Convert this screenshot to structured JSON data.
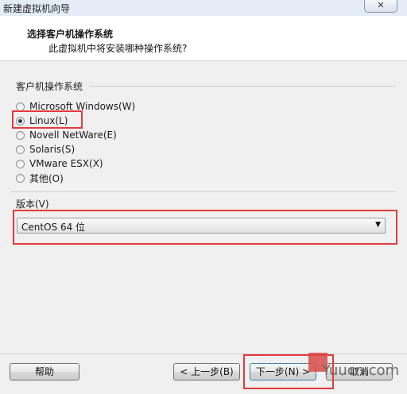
{
  "window": {
    "title": "新建虚拟机向导",
    "close_label": "✕"
  },
  "header": {
    "title": "选择客户机操作系统",
    "subtitle": "此虚拟机中将安装哪种操作系统?"
  },
  "os_group": {
    "label": "客户机操作系统",
    "options": [
      {
        "label": "Microsoft Windows(W)",
        "selected": false
      },
      {
        "label": "Linux(L)",
        "selected": true
      },
      {
        "label": "Novell NetWare(E)",
        "selected": false
      },
      {
        "label": "Solaris(S)",
        "selected": false
      },
      {
        "label": "VMware ESX(X)",
        "selected": false
      },
      {
        "label": "其他(O)",
        "selected": false
      }
    ]
  },
  "version": {
    "label": "版本(V)",
    "selected": "CentOS 64 位"
  },
  "buttons": {
    "help": "帮助",
    "back": "< 上一步(B)",
    "next": "下一步(N) >",
    "cancel": "取消"
  },
  "watermark": {
    "text": "Yuucn.com"
  },
  "colors": {
    "highlight_box": "#e53a3a",
    "header_bg": "#ffffff",
    "body_bg": "#f0f0f0"
  }
}
